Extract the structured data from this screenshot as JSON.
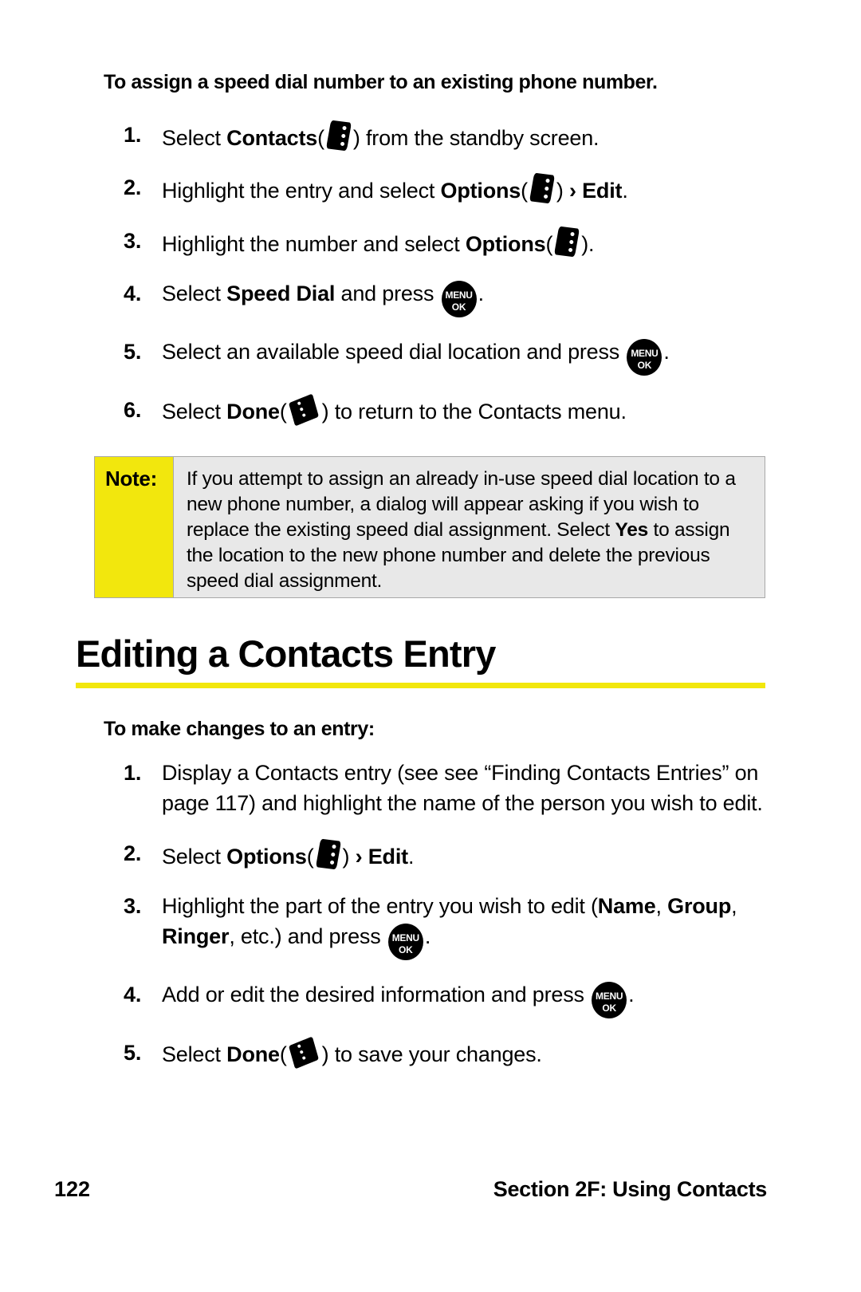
{
  "page": {
    "number": "122",
    "section_footer": "Section 2F: Using Contacts"
  },
  "procedure_1": {
    "intro": "To assign a speed dial number to an existing phone number.",
    "steps": [
      {
        "num": "1.",
        "pre": "Select ",
        "bold": "Contacts",
        "paren_open": "(",
        "icon": "softkey-options-icon",
        "paren_close": ")",
        "post": " from the standby screen."
      },
      {
        "num": "2.",
        "pre": "Highlight the entry and select ",
        "bold": "Options",
        "paren_open": "(",
        "icon": "softkey-options-icon",
        "paren_close": ")",
        "post": " ",
        "bold2": "› Edit",
        "post2": "."
      },
      {
        "num": "3.",
        "pre": "Highlight the number and select ",
        "bold": "Options",
        "paren_open": "(",
        "icon": "softkey-options-icon",
        "paren_close": ")",
        "post": "."
      },
      {
        "num": "4.",
        "pre": "Select ",
        "bold": "Speed Dial",
        "mid": " and press ",
        "icon": "menu-ok-button",
        "post": "."
      },
      {
        "num": "5.",
        "pre": "Select an available speed dial location and press ",
        "icon": "menu-ok-button",
        "post": "."
      },
      {
        "num": "6.",
        "pre": "Select ",
        "bold": "Done",
        "paren_open": "(",
        "icon": "softkey-done-icon",
        "paren_close": ")",
        "post": " to return to the Contacts menu."
      }
    ]
  },
  "note": {
    "label": "Note:",
    "text_part1": "If you attempt to assign an already in-use speed dial location to a new phone number, a dialog will appear asking if you wish to replace the existing speed dial assignment. Select ",
    "bold": "Yes",
    "text_part2": " to assign the location to the new phone number and delete the previous speed dial assignment."
  },
  "section": {
    "heading": "Editing a Contacts Entry",
    "intro": "To make changes to an entry:",
    "steps": [
      {
        "num": "1.",
        "text": "Display a Contacts entry (see see “Finding Contacts Entries” on page 117) and highlight the name of the person you wish to edit."
      },
      {
        "num": "2.",
        "pre": "Select ",
        "bold": "Options",
        "paren_open": "(",
        "icon": "softkey-options-icon",
        "paren_close": ")",
        "post": " ",
        "bold2": "› Edit",
        "post2": "."
      },
      {
        "num": "3.",
        "pre": "Highlight the part of the entry you wish to edit (",
        "bold": "Name",
        "mid1": ", ",
        "bold2": "Group",
        "mid2": ", ",
        "bold3": "Ringer",
        "mid3": ", etc.) and press ",
        "icon": "menu-ok-button",
        "post": "."
      },
      {
        "num": "4.",
        "pre": "Add or edit the desired information and press ",
        "icon": "menu-ok-button",
        "post": "."
      },
      {
        "num": "5.",
        "pre": "Select ",
        "bold": "Done",
        "paren_open": "(",
        "icon": "softkey-done-icon",
        "paren_close": ")",
        "post": " to save your changes."
      }
    ]
  },
  "icons": {
    "menu_ok_top": "MENU",
    "menu_ok_bottom": "OK"
  },
  "colors": {
    "note_label_bg": "#f2e70d",
    "note_body_bg": "#e8e8e8",
    "note_border": "#a8a8a8",
    "heading_rule": "#f2e70d",
    "text": "#000000"
  }
}
